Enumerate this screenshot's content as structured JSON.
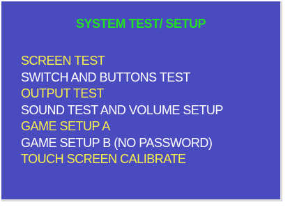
{
  "colors": {
    "background": "#4b4bc0",
    "title": "#22e022",
    "highlight": "#f7f04a",
    "normal": "#ffffff"
  },
  "header": {
    "title": "SYSTEM TEST/ SETUP"
  },
  "menu": {
    "items": [
      {
        "label": "SCREEN TEST",
        "style": "highlight"
      },
      {
        "label": "SWITCH AND BUTTONS TEST",
        "style": "normal"
      },
      {
        "label": "OUTPUT TEST",
        "style": "highlight"
      },
      {
        "label": "SOUND TEST AND VOLUME SETUP",
        "style": "normal"
      },
      {
        "label": "GAME SETUP A",
        "style": "highlight"
      },
      {
        "label": "GAME SETUP B (NO PASSWORD)",
        "style": "normal"
      },
      {
        "label": "TOUCH SCREEN CALIBRATE",
        "style": "highlight"
      }
    ]
  }
}
